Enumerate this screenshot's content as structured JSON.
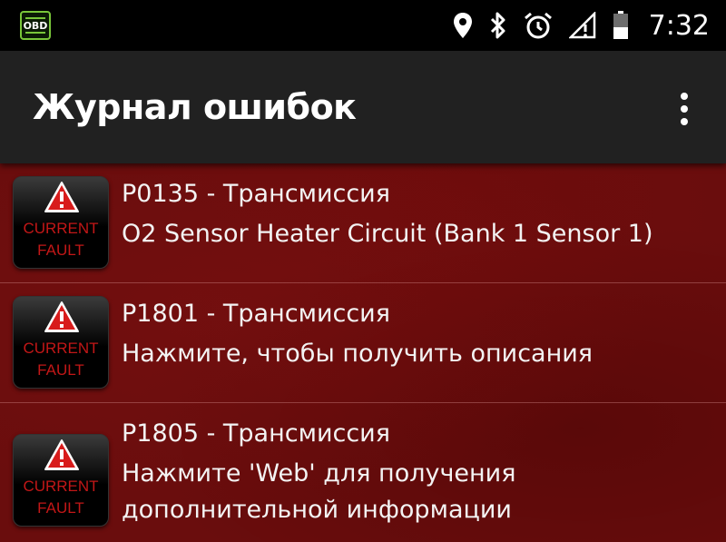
{
  "status_bar": {
    "app_icon_label": "OBD",
    "time": "7:32",
    "icons": [
      "location-icon",
      "bluetooth-icon",
      "alarm-icon",
      "signal-icon",
      "battery-icon"
    ]
  },
  "app_bar": {
    "title": "Журнал ошибок",
    "menu_icon": "overflow-menu-icon"
  },
  "faults": [
    {
      "code": "P0135 - Трансмиссия",
      "description": "O2 Sensor Heater Circuit (Bank 1 Sensor 1)",
      "badge_line1": "CURRENT",
      "badge_line2": "FAULT"
    },
    {
      "code": "P1801 - Трансмиссия",
      "description": "Нажмите, чтобы получить описания",
      "badge_line1": "CURRENT",
      "badge_line2": "FAULT"
    },
    {
      "code": "P1805 - Трансмиссия",
      "description": "Нажмите 'Web' для получения дополнительной информации",
      "badge_line1": "CURRENT",
      "badge_line2": "FAULT"
    }
  ],
  "colors": {
    "status_bar_bg": "#000000",
    "app_bar_bg": "#212121",
    "list_bg": "#6a0d0d",
    "badge_text": "#c21717",
    "obd_green": "#79c63a"
  }
}
